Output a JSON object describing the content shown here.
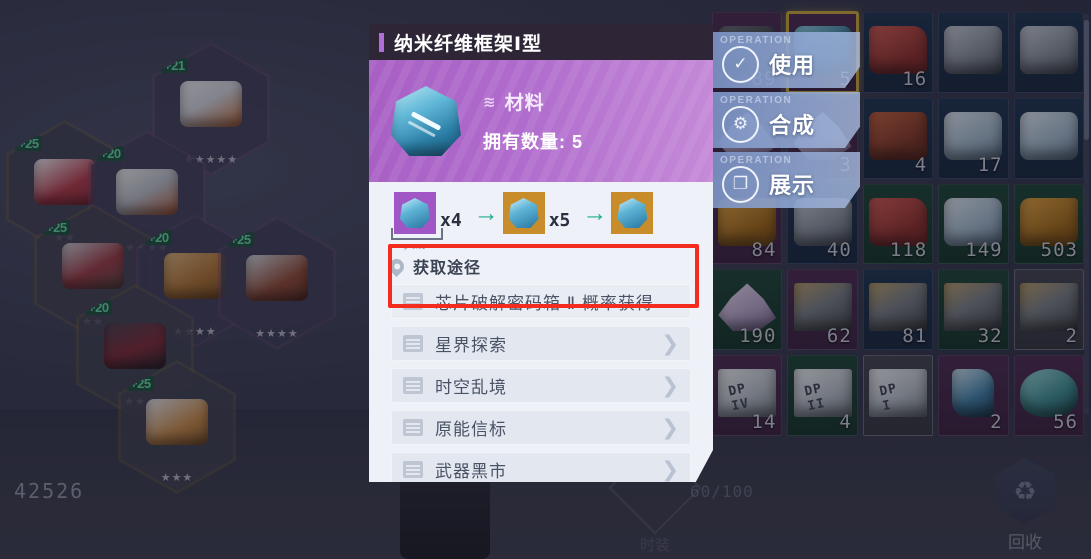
{
  "panel": {
    "title": "纳米纤维框架Ⅰ型",
    "type_label": "材料",
    "type_icon": "layers-icon",
    "count_label": "拥有数量:  5",
    "item_icon": "nano-frame-icon",
    "chain": {
      "slot1_sub": "p=0.01",
      "mult1": "x4",
      "mult2": "x5",
      "arrow": "→"
    },
    "ways_title": "获取途径",
    "ways": [
      {
        "label": "芯片破解密码箱 Ⅱ 概率获得",
        "icon": "chip-case-icon",
        "chevron": "",
        "highlighted": true
      },
      {
        "label": "星界探索",
        "icon": "star-realm-icon",
        "chevron": "❯",
        "highlighted": false
      },
      {
        "label": "时空乱境",
        "icon": "rift-icon",
        "chevron": "❯",
        "highlighted": false
      },
      {
        "label": "原能信标",
        "icon": "beacon-icon",
        "chevron": "❯",
        "highlighted": false
      },
      {
        "label": "武器黑市",
        "icon": "blackmarket-icon",
        "chevron": "❯",
        "highlighted": false
      }
    ]
  },
  "operations": [
    {
      "tag": "OPERATION",
      "label": "使用",
      "icon": "check-circle-icon"
    },
    {
      "tag": "OPERATION",
      "label": "合成",
      "icon": "synthesize-icon"
    },
    {
      "tag": "OPERATION",
      "label": "展示",
      "icon": "display-icon"
    }
  ],
  "inventory": {
    "rows": [
      [
        {
          "q": "89",
          "rarity": "r-purple",
          "blob": "b-dark",
          "sel": false
        },
        {
          "q": "5",
          "rarity": "r-purple",
          "blob": "b-cyan",
          "sel": true
        },
        {
          "q": "16",
          "rarity": "r-blue",
          "blob": "b-red",
          "sel": false
        },
        {
          "q": "",
          "rarity": "r-blue",
          "blob": "b-stone",
          "sel": false
        },
        {
          "q": "",
          "rarity": "r-blue",
          "blob": "b-stone",
          "sel": false
        }
      ],
      [
        {
          "q": "",
          "rarity": "r-purple",
          "blob": "b-lilac",
          "sel": false
        },
        {
          "q": "3",
          "rarity": "r-purple",
          "blob": "b-lilac",
          "sel": false
        },
        {
          "q": "4",
          "rarity": "r-blue",
          "blob": "b-rust",
          "sel": false
        },
        {
          "q": "17",
          "rarity": "r-blue",
          "blob": "b-ice",
          "sel": false
        },
        {
          "q": "",
          "rarity": "r-blue",
          "blob": "b-ice",
          "sel": false
        }
      ],
      [
        {
          "q": "84",
          "rarity": "r-purple",
          "blob": "b-amber",
          "sel": false
        },
        {
          "q": "40",
          "rarity": "r-blue",
          "blob": "b-stone",
          "sel": false
        },
        {
          "q": "118",
          "rarity": "r-green",
          "blob": "b-red",
          "sel": false
        },
        {
          "q": "149",
          "rarity": "r-green",
          "blob": "b-ice",
          "sel": false
        },
        {
          "q": "503",
          "rarity": "r-green",
          "blob": "b-amber",
          "sel": false
        }
      ],
      [
        {
          "q": "190",
          "rarity": "r-green",
          "blob": "b-lilac",
          "sel": false
        },
        {
          "q": "62",
          "rarity": "r-purple",
          "blob": "b-crate",
          "sel": false
        },
        {
          "q": "81",
          "rarity": "r-blue",
          "blob": "b-crate",
          "sel": false
        },
        {
          "q": "32",
          "rarity": "r-green",
          "blob": "b-crate",
          "sel": false
        },
        {
          "q": "2",
          "rarity": "r-grey",
          "blob": "b-crate",
          "sel": false
        }
      ],
      [
        {
          "q": "14",
          "rarity": "r-purple",
          "blob": "b-card",
          "card": "DP IV",
          "sel": false
        },
        {
          "q": "4",
          "rarity": "r-green",
          "blob": "b-card",
          "card": "DP II",
          "sel": false
        },
        {
          "q": "",
          "rarity": "r-grey",
          "blob": "b-card",
          "card": "DP I",
          "sel": false
        },
        {
          "q": "2",
          "rarity": "r-purple",
          "blob": "b-flask",
          "sel": false
        },
        {
          "q": "56",
          "rarity": "r-purple",
          "blob": "b-teal",
          "sel": false
        }
      ]
    ]
  },
  "hud": {
    "currency": "42526",
    "capacity": "60/100",
    "recycle_label": "回收",
    "recycle_icon": "recycle-icon",
    "dummy_label": "时装"
  },
  "equipment": [
    {
      "level": "+21",
      "stars": "★★★★★",
      "sprite": "sp-a",
      "ring": "mag"
    },
    {
      "level": "+25",
      "stars": "★★",
      "sprite": "sp-c",
      "ring": "gold"
    },
    {
      "level": "+20",
      "stars": "★★★★",
      "sprite": "sp-b",
      "ring": "mag"
    },
    {
      "level": "+25",
      "stars": "★★",
      "sprite": "sp-g",
      "ring": "gold"
    },
    {
      "level": "+20",
      "stars": "★★★★",
      "sprite": "sp-d",
      "ring": "mag"
    },
    {
      "level": "+25",
      "stars": "★★★★",
      "sprite": "sp-e",
      "ring": "mag"
    },
    {
      "level": "+20",
      "stars": "★★",
      "sprite": "sp-f",
      "ring": "gold"
    },
    {
      "level": "+25",
      "stars": "★★★",
      "sprite": "sp-h",
      "ring": "gold"
    }
  ],
  "colors": {
    "accent_purple": "#b06fd8",
    "hero_gradient": "#a85fc4",
    "highlight_red": "#f42c20",
    "selected_gold": "#c9a53c",
    "op_blue": "#8aa4d6"
  }
}
